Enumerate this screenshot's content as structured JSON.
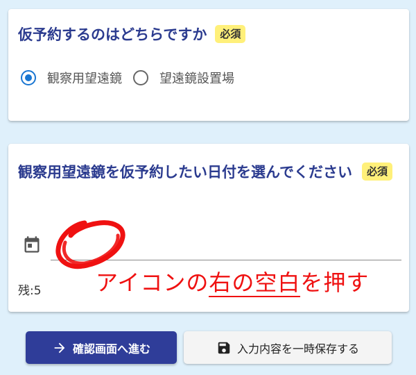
{
  "question1": {
    "title": "仮予約するのはどちらですか",
    "required": "必須",
    "options": [
      {
        "label": "観察用望遠鏡",
        "selected": true
      },
      {
        "label": "望遠鏡設置場",
        "selected": false
      }
    ]
  },
  "question2": {
    "title": "観察用望遠鏡を仮予約したい日付を選んでください",
    "required": "必須",
    "date_value": "",
    "remaining": "残:5"
  },
  "annotation": {
    "prefix": "アイコンの",
    "highlight": "右の空白",
    "suffix": "を押す",
    "color": "#ef1111"
  },
  "buttons": {
    "next": "確認画面へ進む",
    "save": "入力内容を一時保存する"
  },
  "icons": {
    "calendar": "calendar-icon",
    "next": "arrow-right-icon",
    "save": "floppy-disk-icon"
  },
  "colors": {
    "background": "#dff0fb",
    "title": "#2b3b8f",
    "badge": "#fff07a",
    "radio_checked": "#1976d2",
    "primary_button": "#2f3d99"
  }
}
